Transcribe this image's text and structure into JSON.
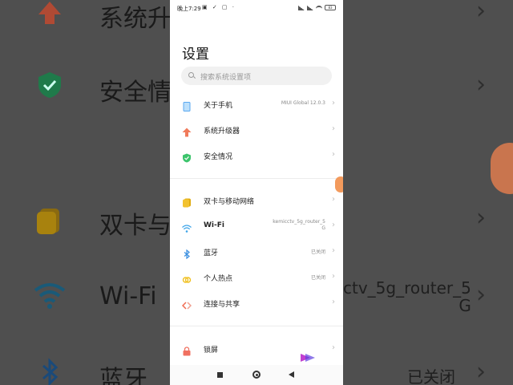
{
  "background": {
    "items": [
      {
        "label": "系统升"
      },
      {
        "label": "安全情"
      },
      {
        "label": "双卡与"
      },
      {
        "label": "Wi-Fi",
        "value": "ctv_5g_router_5\nG"
      },
      {
        "label": "蓝牙",
        "value": "已关闭"
      }
    ]
  },
  "status_bar": {
    "time": "晚上7:29",
    "battery": "83"
  },
  "page": {
    "title": "设置"
  },
  "search": {
    "placeholder": "搜索系统设置项"
  },
  "settings": {
    "items": [
      {
        "label": "关于手机",
        "value": "MIUI Global 12.0.3",
        "icon": "phone-icon",
        "color": "#5aa8f0"
      },
      {
        "label": "系统升级器",
        "value": "",
        "icon": "upgrade-arrow-icon",
        "color": "#f07a5a"
      },
      {
        "label": "安全情况",
        "value": "",
        "icon": "shield-check-icon",
        "color": "#3cc46c"
      },
      {
        "label": "双卡与移动网络",
        "value": "",
        "icon": "sim-card-icon",
        "color": "#f2c230"
      },
      {
        "label": "Wi-Fi",
        "value": "kemicctv_5g_router_5\nG",
        "icon": "wifi-icon",
        "color": "#3aa3e8"
      },
      {
        "label": "蓝牙",
        "value": "已关闭",
        "icon": "bluetooth-icon",
        "color": "#3a8fe0"
      },
      {
        "label": "个人热点",
        "value": "已关闭",
        "icon": "hotspot-icon",
        "color": "#f0c020"
      },
      {
        "label": "连接与共享",
        "value": "",
        "icon": "connection-sharing-icon",
        "color": "#f06a50"
      },
      {
        "label": "锁屏",
        "value": "",
        "icon": "lock-icon",
        "color": "#f07060"
      }
    ]
  },
  "nav": {
    "recents": "recents-icon",
    "home": "home-icon",
    "back": "back-icon"
  }
}
